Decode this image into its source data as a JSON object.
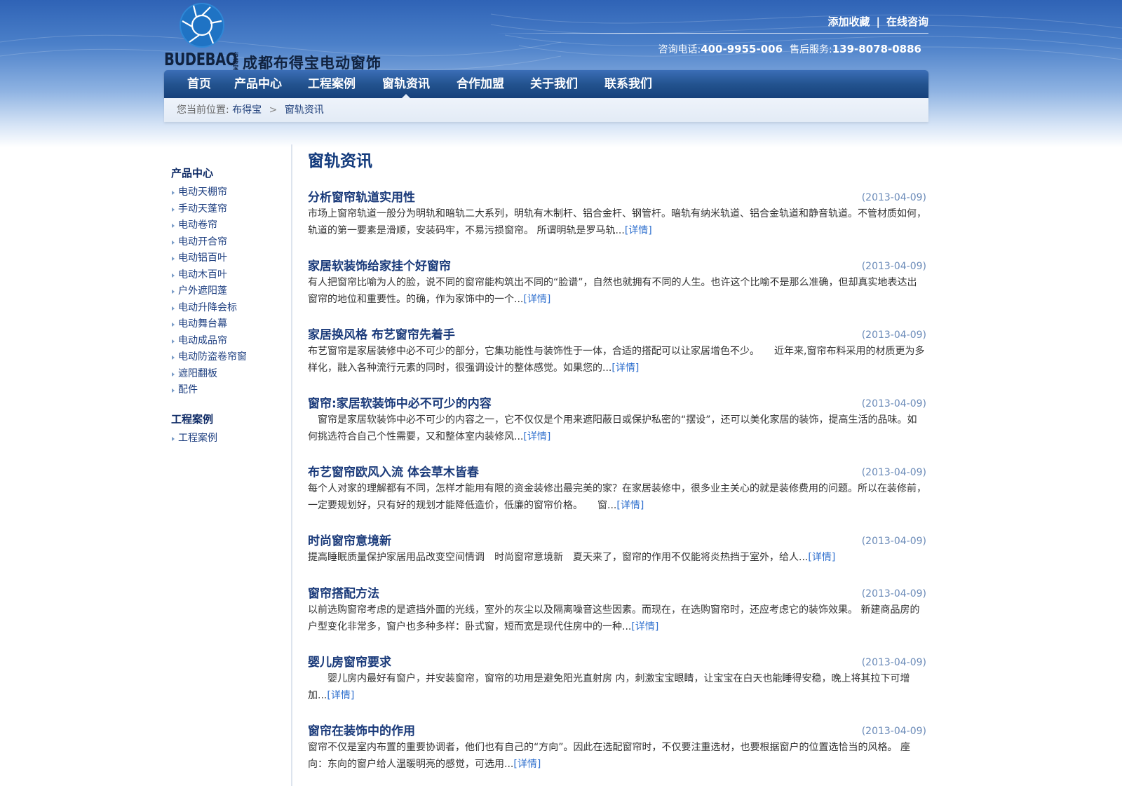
{
  "header": {
    "brand_en": "BUDEBAO",
    "brand_small": "布得宝",
    "brand_cn": "成都布得宝电动窗饰",
    "links": {
      "favorite": "添加收藏",
      "separator": "|",
      "consult": "在线咨询"
    },
    "hotline": {
      "label1": "咨询电话:",
      "number1": "400-9955-006",
      "label2": "售后服务:",
      "number2": "139-8078-0886"
    }
  },
  "nav": {
    "items": [
      "首页",
      "产品中心",
      "工程案例",
      "窗轨资讯",
      "合作加盟",
      "关于我们",
      "联系我们"
    ],
    "active_index": 3
  },
  "breadcrumb": {
    "prefix": "您当前位置:",
    "home": "布得宝",
    "separator": ">",
    "current": "窗轨资讯"
  },
  "sidebar": {
    "sections": [
      {
        "title": "产品中心",
        "items": [
          "电动天棚帘",
          "手动天蓬帘",
          "电动卷帘",
          "电动开合帘",
          "电动铝百叶",
          "电动木百叶",
          "户外遮阳蓬",
          "电动升降会标",
          "电动舞台幕",
          "电动成品帘",
          "电动防盗卷帘窗",
          "遮阳翻板",
          "配件"
        ]
      },
      {
        "title": "工程案例",
        "items": [
          "工程案例"
        ]
      }
    ]
  },
  "main": {
    "title": "窗轨资讯",
    "more_label": "[详情]",
    "articles": [
      {
        "title": "分析窗帘轨道实用性",
        "date": "(2013-04-09)",
        "summary": "市场上窗帘轨道一般分为明轨和暗轨二大系列，明轨有木制杆、铝合金杆、钢管杆。暗轨有纳米轨道、铝合金轨道和静音轨道。不管材质如何，轨道的第一要素是滑顺，安装码牢，不易污损窗帘。 所谓明轨是罗马轨..."
      },
      {
        "title": "家居软装饰给家挂个好窗帘",
        "date": "(2013-04-09)",
        "summary": "有人把窗帘比喻为人的脸，说不同的窗帘能构筑出不同的“脸谱”，自然也就拥有不同的人生。也许这个比喻不是那么准确，但却真实地表达出窗帘的地位和重要性。的确，作为家饰中的一个..."
      },
      {
        "title": "家居换风格 布艺窗帘先着手",
        "date": "(2013-04-09)",
        "summary": "布艺窗帘是家居装修中必不可少的部分，它集功能性与装饰性于一体，合适的搭配可以让家居增色不少。　　近年来,窗帘布料采用的材质更为多样化，融入各种流行元素的同时，很强调设计的整体感觉。如果您的..."
      },
      {
        "title": "窗帘:家居软装饰中必不可少的内容",
        "date": "(2013-04-09)",
        "summary": "　窗帘是家居软装饰中必不可少的内容之一，它不仅仅是个用来遮阳蔽日或保护私密的“摆设”，还可以美化家居的装饰，提高生活的品味。如何挑选符合自己个性需要，又和整体室内装修风..."
      },
      {
        "title": "布艺窗帘欧风入流 体会草木皆春",
        "date": "(2013-04-09)",
        "summary": "每个人对家的理解都有不同，怎样才能用有限的资金装修出最完美的家？在家居装修中，很多业主关心的就是装修费用的问题。所以在装修前，一定要规划好，只有好的规划才能降低造价，低廉的窗帘价格。　　窗..."
      },
      {
        "title": "时尚窗帘意境新",
        "date": "(2013-04-09)",
        "summary": " 提高睡眠质量保护家居用品改变空间情调　时尚窗帘意境新　夏天来了，窗帘的作用不仅能将炎热挡于室外，给人..."
      },
      {
        "title": "窗帘搭配方法",
        "date": "(2013-04-09)",
        "summary": "以前选购窗帘考虑的是遮挡外面的光线，室外的灰尘以及隔离噪音这些因素。而现在，在选购窗帘时，还应考虑它的装饰效果。 新建商品房的户型变化非常多，窗户也多种多样：卧式窗，短而宽是现代住房中的一种..."
      },
      {
        "title": "婴儿房窗帘要求",
        "date": "(2013-04-09)",
        "summary": "　　婴儿房内最好有窗户，并安装窗帘，窗帘的功用是避免阳光直射房 内，刺激宝宝眼睛，让宝宝在白天也能睡得安稳，晚上将其拉下可增加..."
      },
      {
        "title": "窗帘在装饰中的作用",
        "date": "(2013-04-09)",
        "summary": "窗帘不仅是室内布置的重要协调者，他们也有自己的“方向”。因此在选配窗帘时，不仅要注重选材，也要根据窗户的位置选恰当的风格。 座向：东向的窗户给人温暖明亮的感觉，可选用..."
      }
    ]
  },
  "colors": {
    "header_blue": "#2f63b6",
    "nav_blue": "#23538f",
    "title_blue": "#123a7c",
    "link_blue": "#2e6fce",
    "date_blue": "#6a8ab8"
  }
}
